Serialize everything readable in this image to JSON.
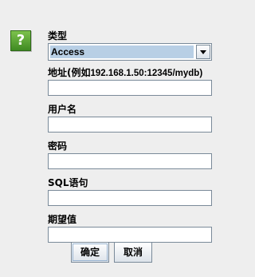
{
  "dialog": {
    "icon": "question-icon",
    "icon_glyph": "?",
    "type_label": "类型",
    "type_value": "Access",
    "address_label": "地址(例如 192.168.1.50:12345/mydb)",
    "address_label_main": "地址(例如",
    "address_label_hint": "192.168.1.50:12345/mydb)",
    "address_value": "",
    "username_label": "用户名",
    "username_value": "",
    "password_label": "密码",
    "password_value": "",
    "sql_label": "SQL语句",
    "sql_value": "",
    "expected_label": "期望值",
    "expected_value": ""
  },
  "buttons": {
    "ok": "确定",
    "cancel": "取消"
  }
}
